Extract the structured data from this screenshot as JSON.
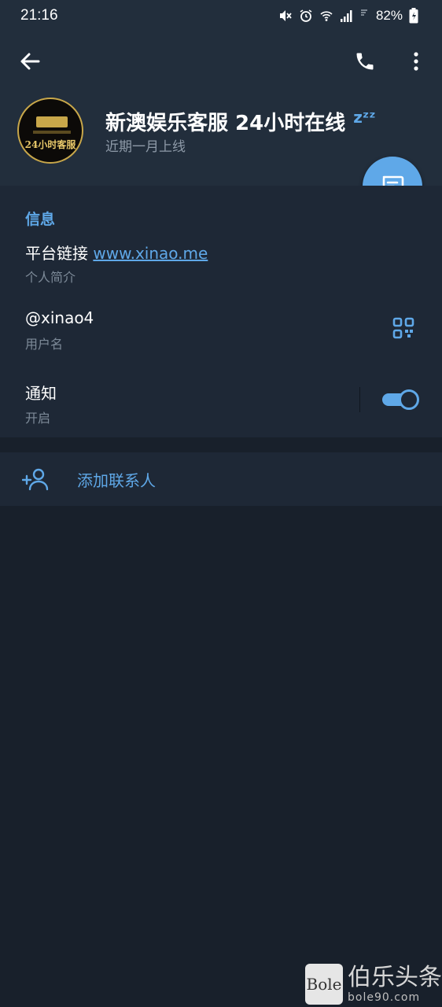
{
  "status_bar": {
    "time": "21:16",
    "battery": "82%"
  },
  "header": {
    "back_icon": "arrow-left-icon",
    "call_icon": "phone-icon",
    "more_icon": "more-vertical-icon",
    "avatar_text": "24小时客服",
    "title": "新澳娱乐客服 24小时在线",
    "title_emoji": "zᶻᶻ",
    "last_seen": "近期一月上线"
  },
  "fab": {
    "icon": "message-icon"
  },
  "info": {
    "section_title": "信息",
    "bio_prefix": "平台链接 ",
    "bio_link": "www.xinao.me",
    "bio_label": "个人简介",
    "username": "@xinao4",
    "username_label": "用户名",
    "qr_icon": "qr-code-icon",
    "notifications": "通知",
    "notifications_status": "开启",
    "notifications_enabled": true
  },
  "add_contact": {
    "icon": "add-user-icon",
    "label": "添加联系人"
  },
  "watermark": {
    "logo_text": "Bole",
    "name": "伯乐头条",
    "url": "bole90.com"
  },
  "colors": {
    "accent": "#5fa8e8",
    "header_bg": "#222e3c",
    "section_bg": "#1e2836",
    "page_bg": "#18202b"
  }
}
